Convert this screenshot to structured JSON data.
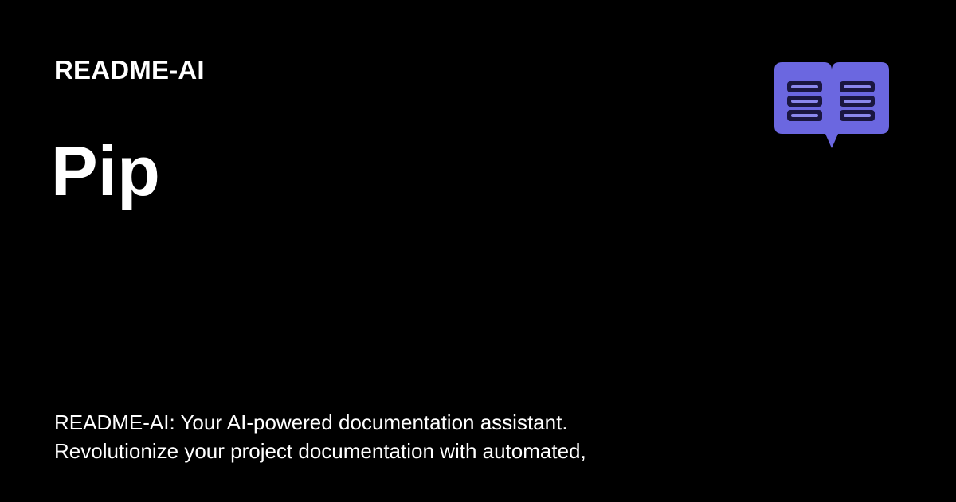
{
  "card": {
    "site_name": "README-AI",
    "title": "Pip",
    "description_lines": [
      "README-AI: Your AI-powered documentation assistant.",
      "Revolutionize your project documentation with automated,"
    ]
  },
  "logo": {
    "icon": "open-book-icon",
    "color": "#6b67e0",
    "line_color": "#1a1640"
  },
  "colors": {
    "background": "#000000",
    "text": "#ffffff"
  }
}
